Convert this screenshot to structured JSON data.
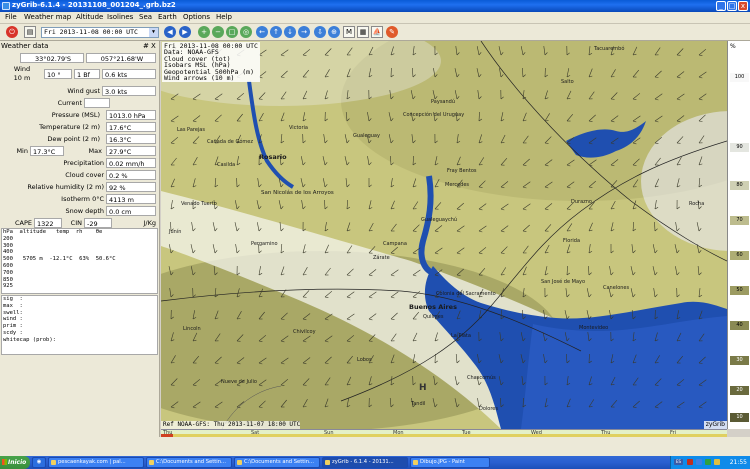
{
  "window": {
    "title": "zyGrib-6.1.4 - 20131108_001204_.grb.bz2",
    "controls": {
      "minimize": "_",
      "maximize": "□",
      "close": "x"
    }
  },
  "menu": [
    "File",
    "Weather map",
    "Altitude",
    "Isolines",
    "Sea",
    "Earth",
    "Options",
    "Help"
  ],
  "toolbar": {
    "date": "Fri 2013-11-08 00:00 UTC"
  },
  "weather_panel": {
    "title": "Weather data",
    "ctrl_pin": "#",
    "ctrl_close": "X",
    "lat": "33°02.79'S",
    "lon": "057°21.68'W",
    "wind_label": "Wind\n10 m",
    "wind_dir": "10 °",
    "wind_bf": "1 Bf",
    "wind_kts": "0.6  kts",
    "wind_gust_label": "Wind gust",
    "wind_gust": "3.0  kts",
    "current_label": "Current",
    "current": "",
    "pressure_label": "Pressure (MSL)",
    "pressure": "1013.0 hPa",
    "temperature_label": "Temperature (2 m)",
    "temperature": "17.6°C",
    "dewpoint_label": "Dew point (2 m)",
    "dewpoint": "16.3°C",
    "min_label": "Min",
    "min": "17.3°C",
    "max_label": "Max",
    "max": "27.9°C",
    "precip_label": "Precipitation",
    "precip": "0.02 mm/h",
    "cloud_label": "Cloud cover",
    "cloud": "0.2 %",
    "humidity_label": "Relative humidity (2 m)",
    "humidity": "92 %",
    "isotherm_label": "Isotherm 0°C",
    "isotherm": "4113 m",
    "snow_label": "Snow depth",
    "snow": "0.0 cm",
    "cape_label": "CAPE",
    "cape": "1322",
    "cin_label": "CIN",
    "cin": "-29",
    "cape_unit": "J/Kg",
    "altitude_table": "hPa  altitude   temp  rh    θe\n200\n300\n400\n500   5705 m  -12.1°C  63%  50.6°C\n600\n700\n850\n925",
    "wave_table": "sig  :\nmax  :\nswell:\nwind :\nprim :\nscdy :\nwhitecap (prob):"
  },
  "map": {
    "info_lines": "Fri 2013-11-08 00:00 UTC\nData: NOAA-GFS\nCloud cover (tot)\nIsobars MSL (hPa)\nGeopotential 500hPa (m)\nWind arrows (10 m)",
    "reference": "Ref NOAA-GFS: Thu 2013-11-07 18:00 UTC",
    "credit": "zyGrib",
    "pressure_center": "H",
    "cities": [
      {
        "name": "Rosario"
      },
      {
        "name": "San Nicolás de los Arroyos"
      },
      {
        "name": "Buenos Aires"
      },
      {
        "name": "Quilmes"
      },
      {
        "name": "La Plata"
      },
      {
        "name": "Montevideo"
      },
      {
        "name": "Colonia del Sacramento"
      },
      {
        "name": "Gualeguaychú"
      },
      {
        "name": "Paysandú"
      },
      {
        "name": "Concepción del Uruguay"
      },
      {
        "name": "Mercedes"
      },
      {
        "name": "Fray Bentos"
      },
      {
        "name": "Tacuarembó"
      },
      {
        "name": "Durazno"
      },
      {
        "name": "Florida"
      },
      {
        "name": "Canelones"
      },
      {
        "name": "San José de Mayo"
      },
      {
        "name": "Rocha"
      },
      {
        "name": "Chivilcoy"
      },
      {
        "name": "Pergamino"
      },
      {
        "name": "Junín"
      },
      {
        "name": "Zárate"
      },
      {
        "name": "Campana"
      },
      {
        "name": "Lobos"
      },
      {
        "name": "Dolores"
      },
      {
        "name": "Chascomús"
      },
      {
        "name": "Victoria"
      },
      {
        "name": "Gualeguay"
      },
      {
        "name": "Venado Tuerto"
      },
      {
        "name": "Casilda"
      },
      {
        "name": "Cañada de Gómez"
      },
      {
        "name": "Las Parejas"
      },
      {
        "name": "Tandil"
      },
      {
        "name": "Salto"
      },
      {
        "name": "Lincoln"
      },
      {
        "name": "Nueve de Julio"
      }
    ]
  },
  "timeline": {
    "days": [
      "Thu",
      "Sat",
      "Sun",
      "Mon",
      "Tue",
      "Wed",
      "Thu",
      "Fri"
    ]
  },
  "colorscale": {
    "unit": "%",
    "ticks": [
      "100",
      "90",
      "80",
      "70",
      "60",
      "50",
      "40",
      "30",
      "20",
      "10"
    ]
  },
  "taskbar": {
    "start": "Inicio",
    "tasks": [
      "pescaenkayak.com | pal...",
      "C:\\Documents and Settin...",
      "C:\\Documents and Settin...",
      "zyGrib - 6.1.4 - 20131...",
      "Dibujo.JPG - Paint"
    ],
    "clock": "21:55",
    "lang": "ES"
  }
}
